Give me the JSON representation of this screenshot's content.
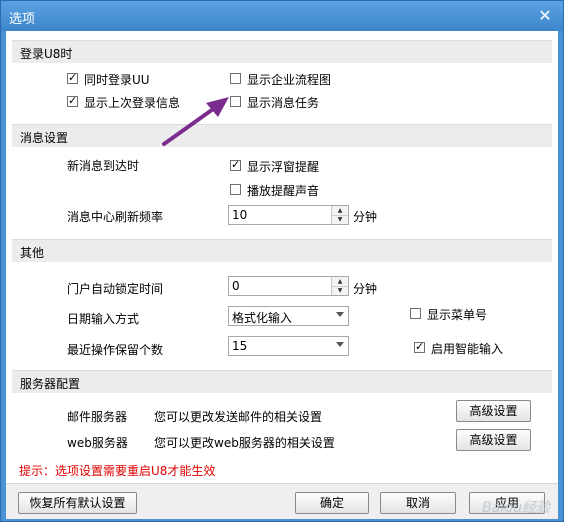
{
  "window": {
    "title": "选项"
  },
  "sections": {
    "login": "登录U8时",
    "message": "消息设置",
    "other": "其他",
    "server": "服务器配置"
  },
  "login": {
    "sync_login_uu": {
      "label": "同时登录UU",
      "checked": true
    },
    "show_last_login": {
      "label": "显示上次登录信息",
      "checked": true
    },
    "show_flowchart": {
      "label": "显示企业流程图",
      "checked": false
    },
    "show_message_task": {
      "label": "显示消息任务",
      "checked": false
    }
  },
  "message": {
    "new_msg_label": "新消息到达时",
    "popup_reminder": {
      "label": "显示浮窗提醒",
      "checked": true
    },
    "play_sound": {
      "label": "播放提醒声音",
      "checked": false
    },
    "refresh_label": "消息中心刷新频率",
    "refresh_value": "10",
    "refresh_unit": "分钟"
  },
  "other": {
    "autolock_label": "门户自动锁定时间",
    "autolock_value": "0",
    "autolock_unit": "分钟",
    "date_input_label": "日期输入方式",
    "date_input_value": "格式化输入",
    "recent_ops_label": "最近操作保留个数",
    "recent_ops_value": "15",
    "show_menu_no": {
      "label": "显示菜单号",
      "checked": false
    },
    "smart_input": {
      "label": "启用智能输入",
      "checked": true
    }
  },
  "server": {
    "mail_label": "邮件服务器",
    "mail_desc": "您可以更改发送邮件的相关设置",
    "mail_btn": "高级设置",
    "web_label": "web服务器",
    "web_desc": "您可以更改web服务器的相关设置",
    "web_btn": "高级设置"
  },
  "hint": "提示：选项设置需要重启U8才能生效",
  "buttons": {
    "restore_defaults": "恢复所有默认设置",
    "ok": "确定",
    "cancel": "取消",
    "apply": "应用"
  },
  "watermark": "Baidu经验",
  "colors": {
    "titlebar": "#3d86cc",
    "hint": "#e00000",
    "annotation_arrow": "#7b2c8f"
  }
}
